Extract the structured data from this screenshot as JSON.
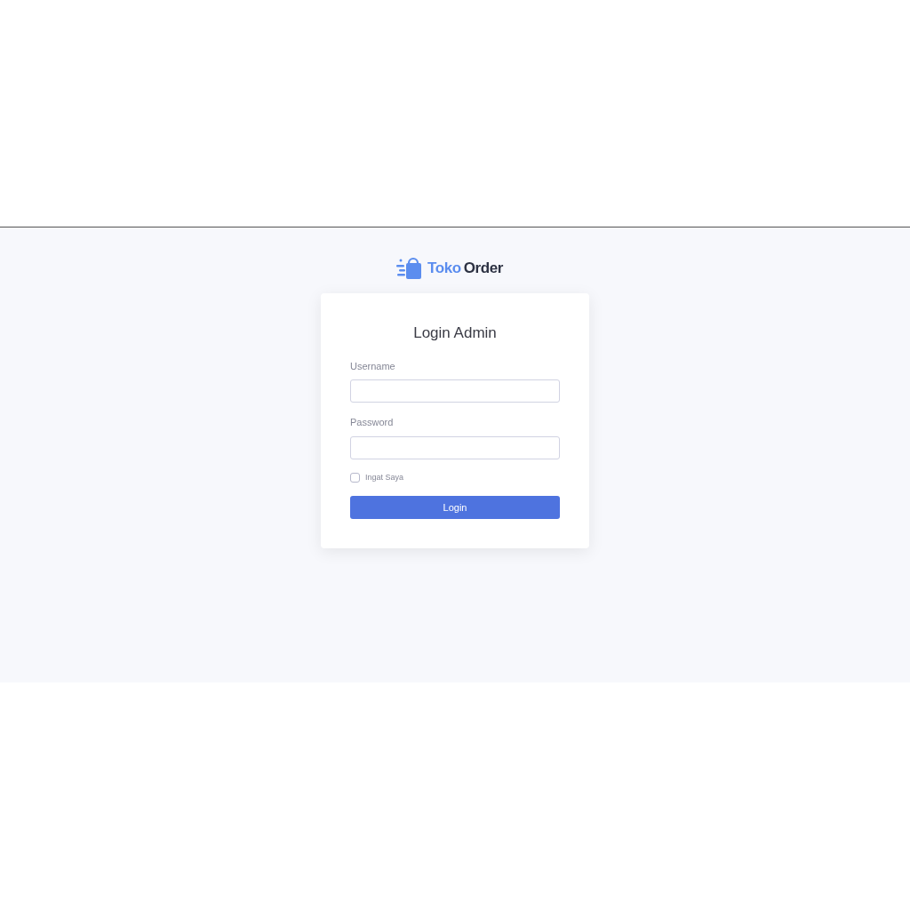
{
  "logo": {
    "word_1": "Toko",
    "word_2": "Order"
  },
  "card": {
    "title": "Login Admin",
    "fields": [
      {
        "label": "Username"
      },
      {
        "label": "Password"
      }
    ],
    "remember": {
      "label": "Ingat Saya",
      "checked": false
    },
    "button": "Login"
  }
}
